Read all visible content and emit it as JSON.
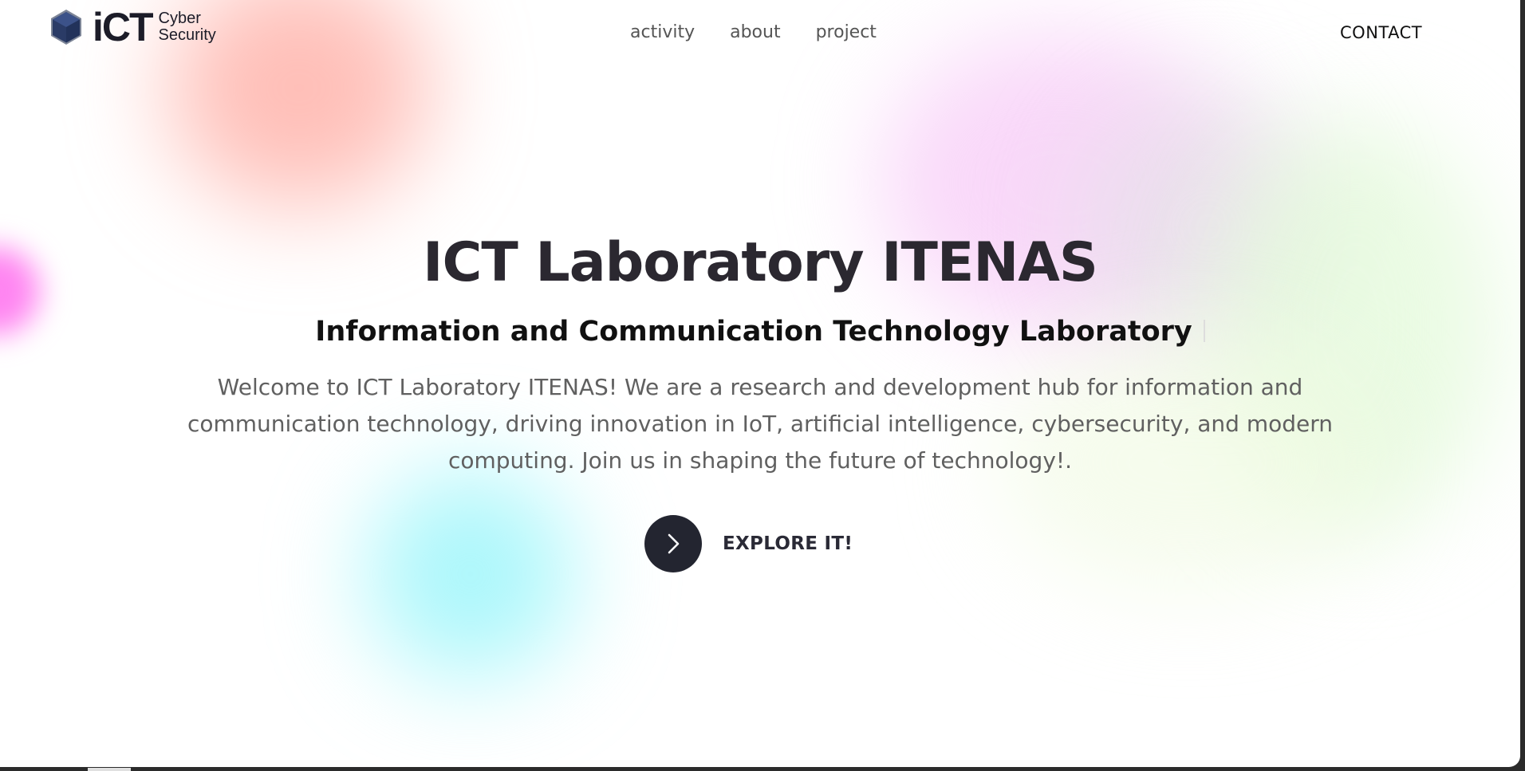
{
  "brand": {
    "word": "iCT",
    "sub_line1": "Cyber",
    "sub_line2": "Security",
    "icon": "cube-logo-icon"
  },
  "nav": {
    "items": [
      {
        "label": "activity"
      },
      {
        "label": "about"
      },
      {
        "label": "project"
      }
    ],
    "contact_label": "CONTACT"
  },
  "hero": {
    "title": "ICT Laboratory ITENAS",
    "subtitle": "Information and Communication Technology Laboratory",
    "body": "Welcome to ICT Laboratory ITENAS! We are a research and development hub for information and communication technology, driving innovation in IoT, artificial intelligence, cybersecurity, and modern computing. Join us in shaping the future of technology!.",
    "cta_label": "EXPLORE IT!",
    "cta_icon": "chevron-right-icon"
  },
  "colors": {
    "text_dark": "#2b2830",
    "cta_circle": "#232530",
    "logo_blue": "#2c3e6b"
  }
}
